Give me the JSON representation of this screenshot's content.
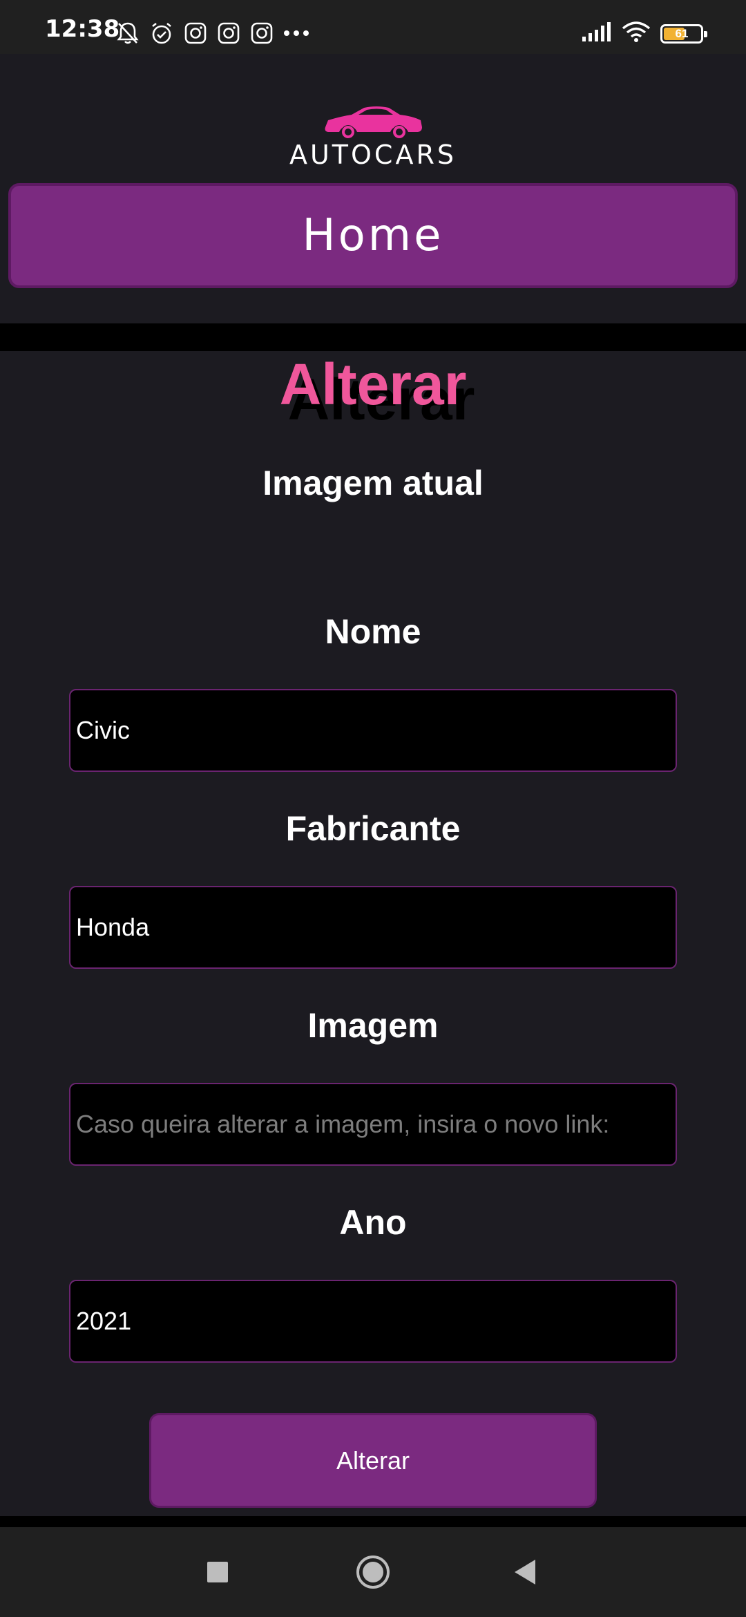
{
  "status_bar": {
    "time": "12:38",
    "battery_level": 61,
    "battery_text": "61",
    "battery_color": "#f2b233",
    "left_icons": [
      "bell-off-icon",
      "alarm-icon",
      "instagram-icon",
      "instagram-icon",
      "instagram-icon",
      "more-dots-icon"
    ],
    "right_icons": [
      "signal-icon",
      "wifi-icon",
      "battery-icon"
    ]
  },
  "header": {
    "logo_text": "AUTOCARS",
    "logo_icon": "car-icon",
    "logo_color": "#e9339e",
    "home_label": "Home",
    "accent": "#7b2a80"
  },
  "form": {
    "title": "Alterar",
    "title_color": "#f0579b",
    "current_image_label": "Imagem atual",
    "nome_label": "Nome",
    "nome_value": "Civic",
    "fabricante_label": "Fabricante",
    "fabricante_value": "Honda",
    "imagem_label": "Imagem",
    "imagem_placeholder": "Caso queira alterar a imagem, insira o novo link:",
    "ano_label": "Ano",
    "ano_value": "2021",
    "submit_label": "Alterar"
  },
  "nav_bar": {
    "buttons": [
      "recents-square-icon",
      "home-circle-icon",
      "back-triangle-icon"
    ]
  }
}
